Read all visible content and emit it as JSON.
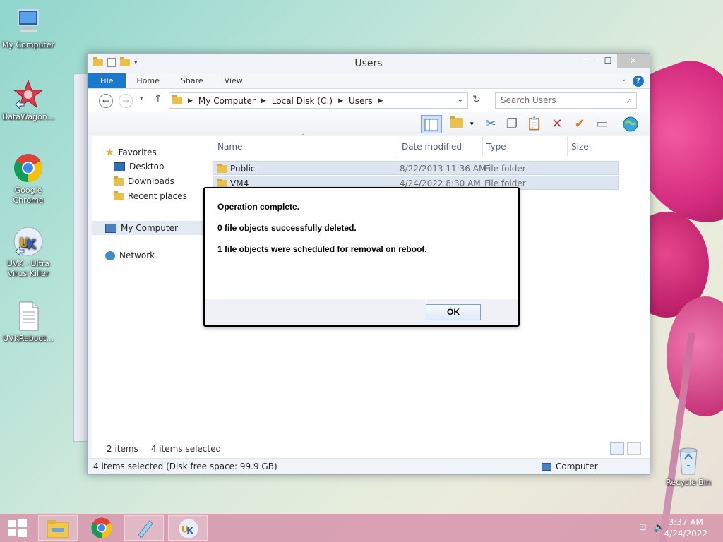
{
  "desktop": {
    "icons": [
      {
        "label": "My Computer"
      },
      {
        "label": "DataWagon..."
      },
      {
        "label": "Google Chrome"
      },
      {
        "label": "UVK - Ultra Virus Killer"
      },
      {
        "label": "UVKReboot..."
      },
      {
        "label": "Recycle Bin"
      }
    ]
  },
  "window": {
    "title": "Users",
    "controls": {
      "minimize": "—",
      "maximize": "☐",
      "close": "✕"
    },
    "ribbon_tabs": [
      "File",
      "Home",
      "Share",
      "View"
    ],
    "help": "?",
    "breadcrumb": [
      "My Computer",
      "Local Disk (C:)",
      "Users"
    ],
    "search_placeholder": "Search Users",
    "nav": {
      "favorites": "Favorites",
      "desktop": "Desktop",
      "downloads": "Downloads",
      "recent": "Recent places",
      "computer": "My Computer",
      "network": "Network"
    },
    "columns": {
      "name": "Name",
      "date": "Date modified",
      "type": "Type",
      "size": "Size"
    },
    "rows": [
      {
        "name": "Public",
        "date": "8/22/2013 11:36 AM",
        "type": "File folder"
      },
      {
        "name": "VM4",
        "date": "4/24/2022 8:30 AM",
        "type": "File folder"
      }
    ],
    "status": {
      "items": "2 items",
      "selected": "4 items selected"
    },
    "details_bar": {
      "left": "4 items selected (Disk free space: 99.9 GB)",
      "right": "Computer"
    }
  },
  "dialog": {
    "line1": "Operation complete.",
    "line2": "0 file objects successfully deleted.",
    "line3": "1 file objects were scheduled for removal on reboot.",
    "ok": "OK"
  },
  "taskbar": {
    "time": "3:37 AM",
    "date": "4/24/2022"
  }
}
